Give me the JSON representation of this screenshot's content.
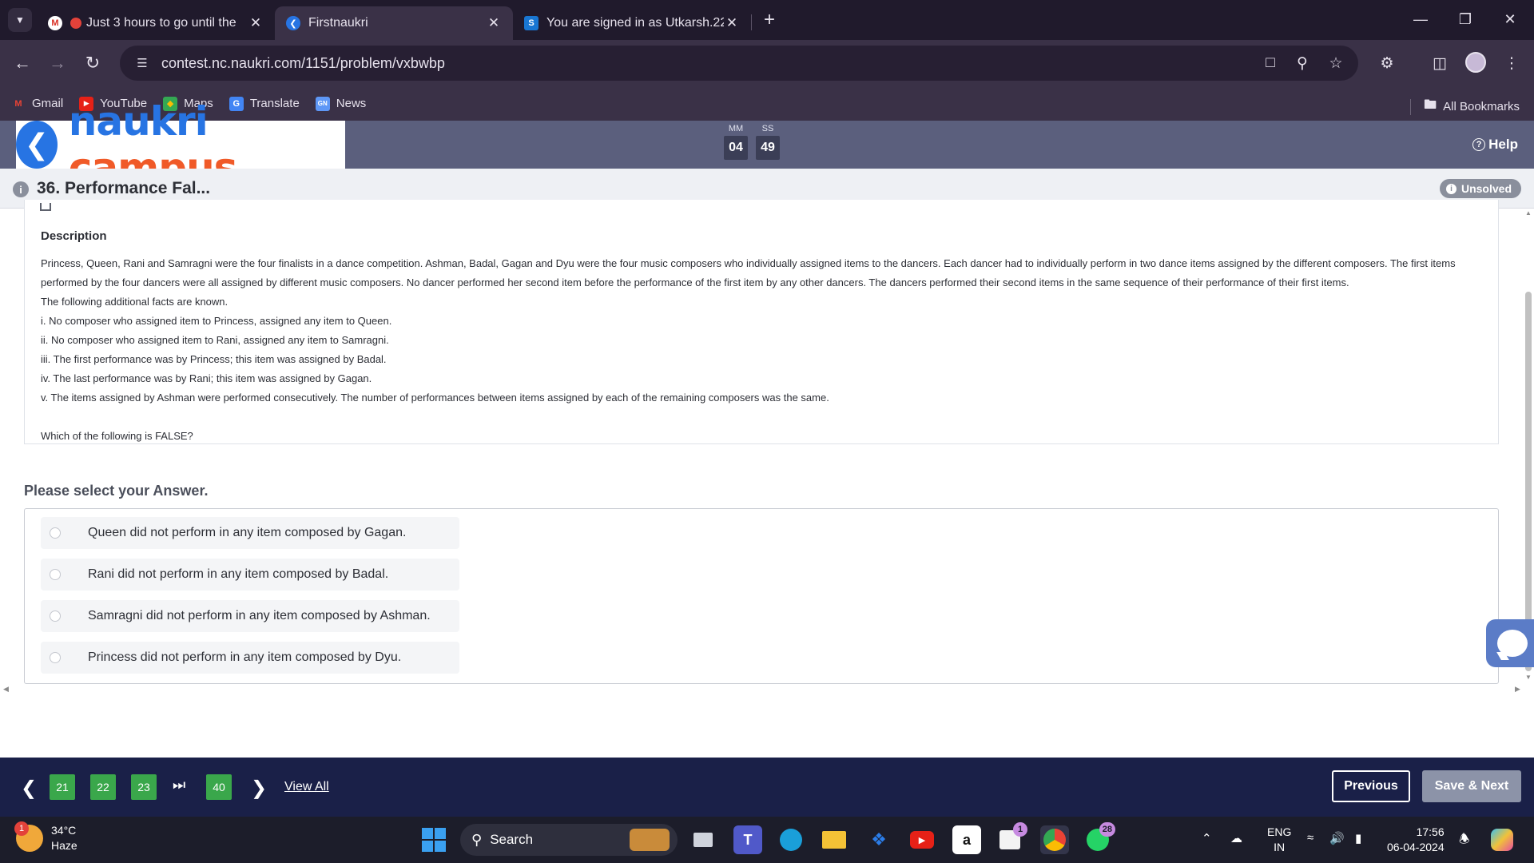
{
  "browser": {
    "tabs": [
      {
        "title": "Just 3 hours to go until the",
        "favicon": "gmail-icon"
      },
      {
        "title": "Firstnaukri",
        "favicon": "naukri-icon"
      },
      {
        "title": "You are signed in as Utkarsh.22",
        "favicon": "s-icon"
      }
    ],
    "url": "contest.nc.naukri.com/1151/problem/vxbwbp",
    "bookmarks": [
      "Gmail",
      "YouTube",
      "Maps",
      "Translate",
      "News"
    ],
    "all_bookmarks": "All Bookmarks"
  },
  "site": {
    "logo_naukri": "naukri",
    "logo_campus": "campus",
    "timer": {
      "mm_label": "MM",
      "ss_label": "SS",
      "mm": "04",
      "ss": "49"
    },
    "help": "Help"
  },
  "question": {
    "title": "36. Performance Fal...",
    "status": "Unsolved",
    "desc_heading": "Description",
    "intro": "Princess, Queen, Rani and Samragni were the four finalists in a dance competition. Ashman, Badal, Gagan and Dyu were the four music composers who individually assigned items to the dancers. Each dancer had to individually perform in two dance items assigned by the different composers. The first items performed by the four dancers were all assigned by different music composers. No dancer performed her second item before the performance of the first item by any other dancers. The dancers performed their second items in the same sequence of their performance of their first items.",
    "facts_intro": "The following additional facts are known.",
    "facts": [
      "i. No composer who assigned item to Princess, assigned any item to Queen.",
      "ii. No composer who assigned item to Rani, assigned any item to Samragni.",
      "iii. The first performance was by Princess; this item was assigned by Badal.",
      "iv. The last performance was by Rani; this item was assigned by Gagan.",
      "v. The items assigned by Ashman were performed consecutively. The number of performances between items assigned by each of the remaining composers was the same."
    ],
    "prompt": "Which of the following is FALSE?"
  },
  "answer": {
    "heading": "Please select your Answer.",
    "options": [
      "Queen did not perform in any item composed by Gagan.",
      "Rani did not perform in any item composed by Badal.",
      "Samragni did not perform in any item composed by Ashman.",
      "Princess did not perform in any item composed by Dyu."
    ]
  },
  "footer": {
    "pages": [
      "21",
      "22",
      "23",
      "40"
    ],
    "view_all": "View All",
    "previous": "Previous",
    "save_next": "Save & Next"
  },
  "taskbar": {
    "weather_temp": "34°C",
    "weather_desc": "Haze",
    "weather_badge": "1",
    "search": "Search",
    "store_badge": "1",
    "whatsapp_badge": "28",
    "lang_1": "ENG",
    "lang_2": "IN",
    "time": "17:56",
    "date": "06-04-2024"
  },
  "colors": {
    "header_bg": "#5b5f7d",
    "footer_bg": "#1a2048",
    "page_badge": "#3aa74b",
    "logo_blue": "#2774e3",
    "logo_orange": "#f05a28"
  }
}
